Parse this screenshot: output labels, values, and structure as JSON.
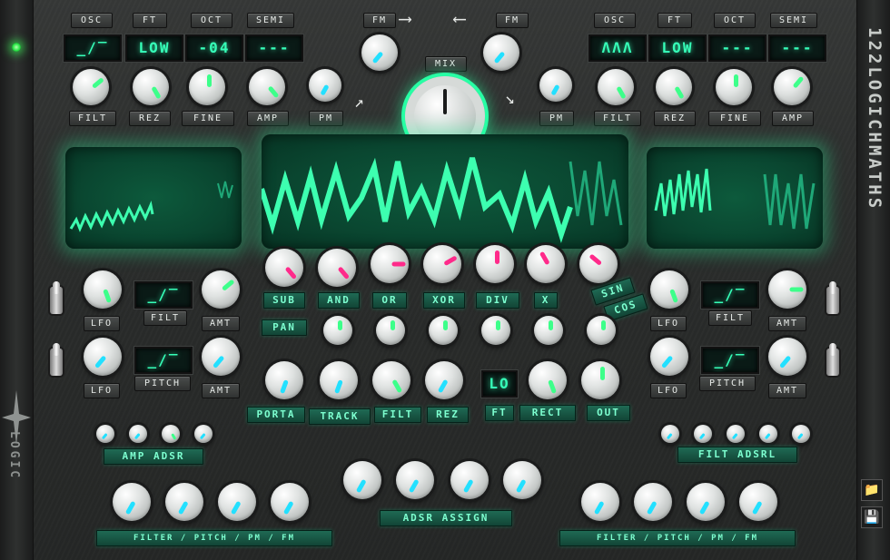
{
  "colors": {
    "accent": "#36ffb8",
    "screen": "#0a4630",
    "plate": "#124536",
    "led": "#2ee84a"
  },
  "brand": {
    "vertical_title": "122LOGICHMATHS",
    "left_logo": "LOGIC"
  },
  "osc1": {
    "osc": "OSC",
    "ft": "FT",
    "oct": "OCT",
    "semi": "SEMI",
    "osc_val": "_/‾",
    "ft_val": "LOW",
    "oct_val": "-04",
    "semi_val": "---",
    "filt": "FILT",
    "rez": "REZ",
    "fine": "FINE",
    "amp": "AMP",
    "pm": "PM",
    "fm": "FM"
  },
  "osc2": {
    "osc": "OSC",
    "ft": "FT",
    "oct": "OCT",
    "semi": "SEMI",
    "osc_val": "ΛΛΛ",
    "ft_val": "LOW",
    "oct_val": "---",
    "semi_val": "---",
    "filt": "FILT",
    "rez": "REZ",
    "fine": "FINE",
    "amp": "AMP",
    "pm": "PM",
    "fm": "FM"
  },
  "mix": "MIX",
  "logic": {
    "sub": "SUB",
    "and": "AND",
    "or": "OR",
    "xor": "XOR",
    "div": "DIV",
    "x": "X",
    "sin": "SIN",
    "cos": "COS",
    "pan": "PAN"
  },
  "lfo_left": {
    "lfo1": "LFO",
    "filt": "FILT",
    "amt1": "AMT",
    "filt_val": "_/‾",
    "lfo2": "LFO",
    "pitch": "PITCH",
    "amt2": "AMT",
    "pitch_val": "_/‾"
  },
  "lfo_right": {
    "lfo1": "LFO",
    "filt": "FILT",
    "amt1": "AMT",
    "filt_val": "_/‾",
    "lfo2": "LFO",
    "pitch": "PITCH",
    "amt2": "AMT",
    "pitch_val": "_/‾"
  },
  "bottom": {
    "porta": "PORTA",
    "track": "TRACK",
    "filt": "FILT",
    "rez": "REZ",
    "ft": "FT",
    "ft_val": "LO",
    "rect": "RECT",
    "out": "OUT",
    "amp_adsr": "AMP ADSR",
    "filt_adsrl": "FILT ADSRL",
    "adsr_assign": "ADSR ASSIGN",
    "assign_left": "FILTER / PITCH / PM / FM",
    "assign_right": "FILTER / PITCH / PM / FM"
  },
  "icons": [
    "folder-icon",
    "save-icon",
    "power-led-icon"
  ]
}
